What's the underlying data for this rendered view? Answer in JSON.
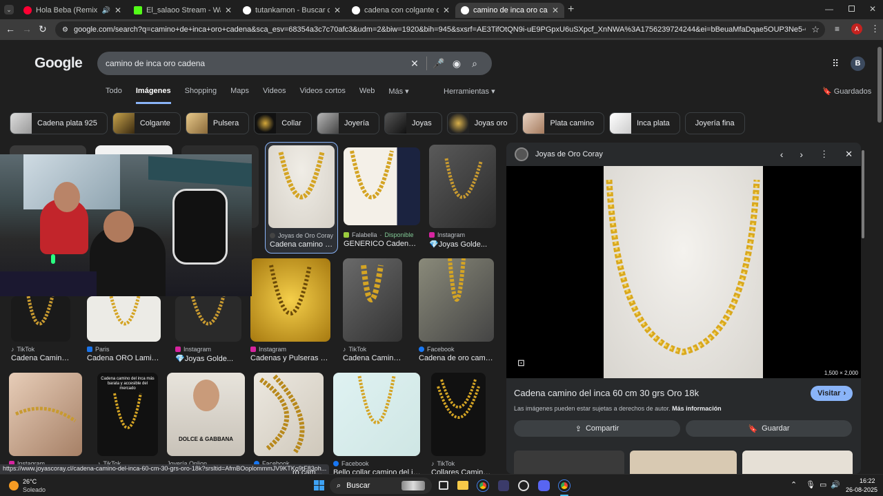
{
  "tabs": [
    {
      "title": "Hola Beba (Remix) - YouTube",
      "color": "#ff0033"
    },
    {
      "title": "El_salaoo Stream - Watch Live o",
      "color": "#53fc18"
    },
    {
      "title": "tutankamon - Buscar con Goog",
      "color": "#ffffff"
    },
    {
      "title": "cadena con colgante de tutank",
      "color": "#ffffff"
    },
    {
      "title": "camino de inca oro cadena - B",
      "color": "#ffffff"
    }
  ],
  "url": "google.com/search?q=camino+de+inca+oro+cadena&sca_esv=68354a3c7c70afc3&udm=2&biw=1920&bih=945&sxsrf=AE3TifOtQN9i-uE9PGpxU6uSXpcf_XnNWA%3A1756239724244&ei=bBeuaMfaDqae5OUP3Ne5-QI&ved=0ahUKEwjHw3npqmPAxUmD...",
  "profile_initial": "A",
  "google": {
    "logo": "Google",
    "query": "camino de inca oro cadena",
    "avatar": "B",
    "nav": [
      "Todo",
      "Imágenes",
      "Shopping",
      "Maps",
      "Videos",
      "Videos cortos",
      "Web",
      "Más"
    ],
    "tools": "Herramientas",
    "saved": "Guardados",
    "chips": [
      "Cadena plata 925",
      "Colgante",
      "Pulsera",
      "Collar",
      "Joyería",
      "Joyas",
      "Joyas oro",
      "Plata camino",
      "Inca plata",
      "Joyería fina"
    ]
  },
  "results_row1": [
    {
      "source": "Joyas de Oro Coray",
      "caption": "Cadena camino de...",
      "extra": ""
    },
    {
      "source": "Falabella",
      "caption": "GENERICO Cadena ...",
      "extra": "Disponible"
    },
    {
      "source": "Instagram",
      "caption": "💎Joyas Golde...",
      "extra": ""
    }
  ],
  "results_row2": [
    {
      "source": "TikTok",
      "caption": "Cadena Camino d..."
    },
    {
      "source": "Paris",
      "caption": "Cadena ORO Laminad..."
    },
    {
      "source": "Instagram",
      "caption": "💎Joyas Golde..."
    },
    {
      "source": "Instagram",
      "caption": "Cadenas y Pulseras Mo..."
    },
    {
      "source": "TikTok",
      "caption": "Cadena Camino d..."
    },
    {
      "source": "Facebook",
      "caption": "Cadena de oro camino ..."
    }
  ],
  "results_row3": [
    {
      "source": "Instagram"
    },
    {
      "source": "TikTok"
    },
    {
      "source": "Joyería Onlion"
    },
    {
      "source": "Facebook"
    },
    {
      "source": "Facebook",
      "caption": "Bello collar camino del inc..."
    },
    {
      "source": "TikTok",
      "caption": "Collares Camino d..."
    }
  ],
  "row3_overlay": "Cadena camino del inca más barata y accesible del mercado",
  "shirt_brand": "DOLCE & GABBANA",
  "panel": {
    "source": "Joyas de Oro Coray",
    "dimensions": "1,500 × 2,000",
    "title": "Cadena camino del inca 60 cm 30 grs Oro 18k",
    "visit": "Visitar",
    "notice": "Las imágenes pueden estar sujetas a derechos de autor.",
    "more_info": "Más información",
    "share": "Compartir",
    "save": "Guardar"
  },
  "status_url": "https://www.joyascoray.cl/cadena-camino-del-inca-60-cm-30-grs-oro-18k?srsltid=AfmBOoplommmJV9KTKo9tF83oh...",
  "status_tail": "ro cam...",
  "taskbar": {
    "temp": "26°C",
    "weather": "Soleado",
    "search": "Buscar",
    "time": "16:22",
    "date": "26-08-2025"
  }
}
